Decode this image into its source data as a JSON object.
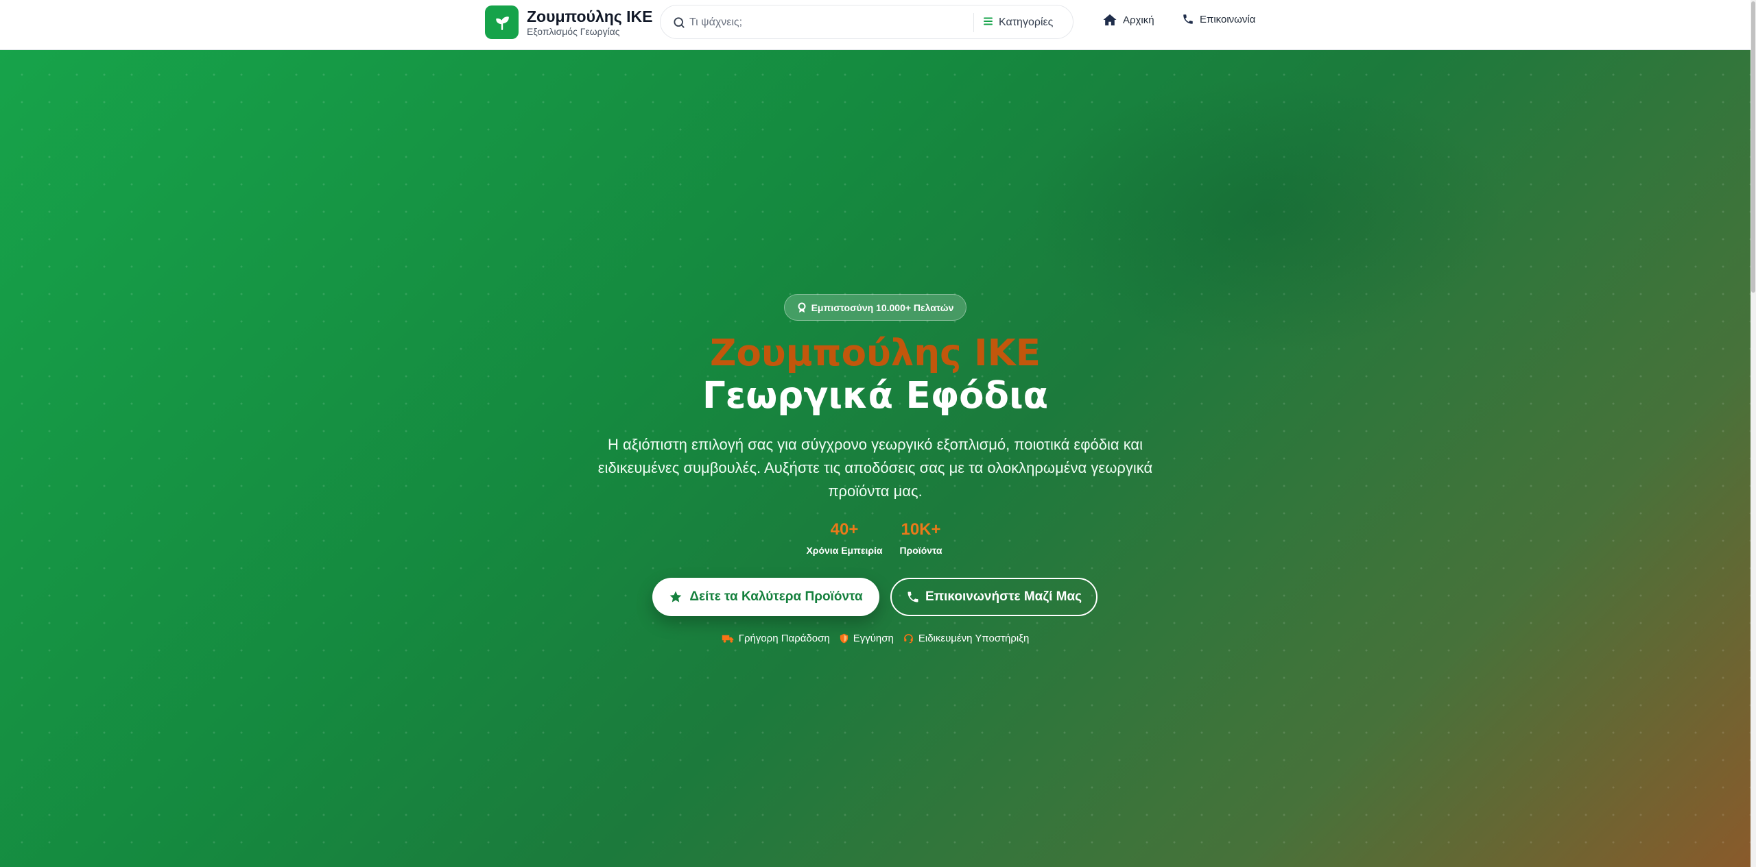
{
  "header": {
    "brand_name": "Ζουμπούλης ΙΚΕ",
    "brand_sub": "Εξοπλισμός Γεωργίας",
    "search_placeholder": "Τι ψάχνεις;",
    "categories_label": "Κατηγορίες",
    "nav": [
      {
        "label": "Αρχική",
        "icon": "home-icon"
      },
      {
        "label": "Επικοινωνία",
        "icon": "phone-icon"
      }
    ]
  },
  "hero": {
    "badge": "Εμπιστοσύνη 10.000+ Πελατών",
    "title_line1": "Ζουμπούλης ΙΚΕ",
    "title_line2": "Γεωργικά Εφόδια",
    "description": "Η αξιόπιστη επιλογή σας για σύγχρονο γεωργικό εξοπλισμό, ποιοτικά εφόδια και ειδικευμένες συμβουλές. Αυξήστε τις αποδόσεις σας με τα ολοκληρωμένα γεωργικά προϊόντα μας.",
    "stats": [
      {
        "value": "40+",
        "label": "Χρόνια Εμπειρία"
      },
      {
        "value": "10K+",
        "label": "Προϊόντα"
      }
    ],
    "cta_primary": "Δείτε τα Καλύτερα Προϊόντα",
    "cta_secondary": "Επικοινωνήστε Μαζί Μας",
    "features": [
      {
        "label": "Γρήγορη Παράδοση",
        "icon": "truck-icon"
      },
      {
        "label": "Εγγύηση",
        "icon": "shield-icon"
      },
      {
        "label": "Ειδικευμένη Υποστήριξη",
        "icon": "headset-icon"
      }
    ]
  },
  "colors": {
    "brand_green": "#16a34a",
    "accent_orange": "#c2570c",
    "stat_orange": "#ea7a1a"
  }
}
